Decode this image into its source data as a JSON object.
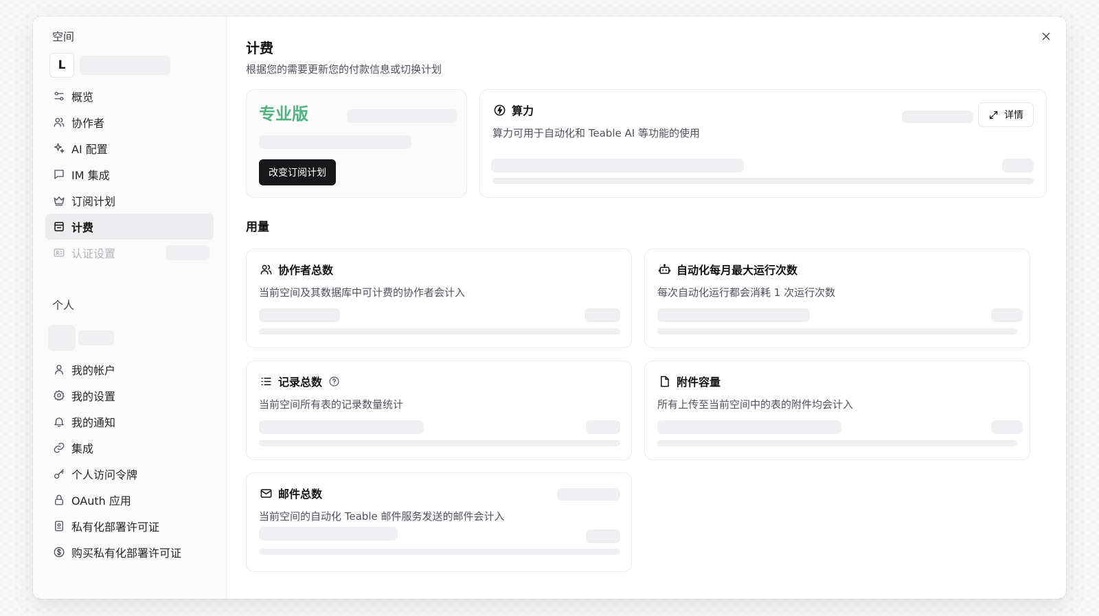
{
  "sidebar": {
    "space_title": "空间",
    "space_avatar": "L",
    "space_items": [
      {
        "label": "概览",
        "icon": "sliders-icon"
      },
      {
        "label": "协作者",
        "icon": "users-icon"
      },
      {
        "label": "AI 配置",
        "icon": "sparkles-icon"
      },
      {
        "label": "IM 集成",
        "icon": "message-icon"
      },
      {
        "label": "订阅计划",
        "icon": "crown-icon"
      },
      {
        "label": "计费",
        "icon": "receipt-icon",
        "active": true
      },
      {
        "label": "认证设置",
        "icon": "id-card-icon",
        "disabled": true
      }
    ],
    "personal_title": "个人",
    "personal_items": [
      {
        "label": "我的帐户",
        "icon": "user-icon"
      },
      {
        "label": "我的设置",
        "icon": "gear-icon"
      },
      {
        "label": "我的通知",
        "icon": "bell-icon"
      },
      {
        "label": "集成",
        "icon": "link-icon"
      },
      {
        "label": "个人访问令牌",
        "icon": "key-icon"
      },
      {
        "label": "OAuth 应用",
        "icon": "lock-icon"
      },
      {
        "label": "私有化部署许可证",
        "icon": "certificate-icon"
      },
      {
        "label": "购买私有化部署许可证",
        "icon": "dollar-circle-icon"
      }
    ]
  },
  "main": {
    "title": "计费",
    "subtitle": "根据您的需要更新您的付款信息或切换计划",
    "plan": {
      "name": "专业版",
      "change_button": "改变订阅计划",
      "accent_color": "#51b37f"
    },
    "compute": {
      "title": "算力",
      "description": "算力可用于自动化和 Teable AI 等功能的使用",
      "detail_button": "详情"
    },
    "usage_title": "用量",
    "usage": [
      {
        "title": "协作者总数",
        "description": "当前空间及其数据库中可计费的协作者会计入",
        "icon": "users-icon"
      },
      {
        "title": "自动化每月最大运行次数",
        "description": "每次自动化运行都会消耗 1 次运行次数",
        "icon": "bot-icon"
      },
      {
        "title": "记录总数",
        "description": "当前空间所有表的记录数量统计",
        "icon": "list-icon"
      },
      {
        "title": "附件容量",
        "description": "所有上传至当前空间中的表的附件均会计入",
        "icon": "file-icon"
      },
      {
        "title": "邮件总数",
        "description": "当前空间的自动化 Teable 邮件服务发送的邮件会计入",
        "icon": "mail-icon"
      }
    ]
  }
}
